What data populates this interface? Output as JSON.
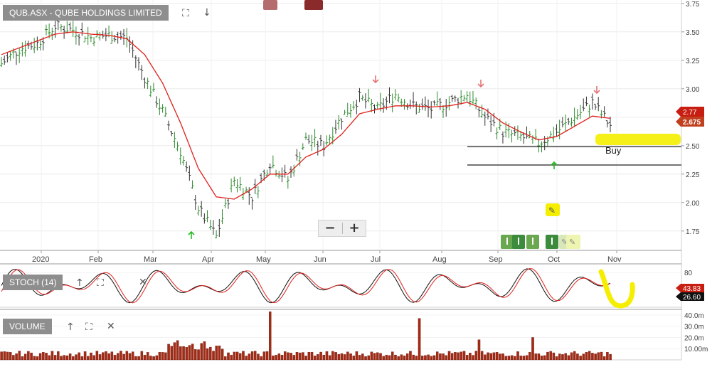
{
  "price_panel": {
    "title": "QUB.ASX - QUBE HOLDINGS LIMITED",
    "buy_label": "Buy"
  },
  "stoch_panel": {
    "title": "STOCH (14)"
  },
  "volume_panel": {
    "title": "VOLUME"
  },
  "price_badges": {
    "ma": "2.77",
    "last": "2.675"
  },
  "stoch_badges": {
    "d": "43.83",
    "k": "26.60"
  },
  "icons": {
    "expand": "expand-icon",
    "move_down": "arrow-down-icon",
    "move_up": "arrow-up-icon",
    "close": "close-icon",
    "zoom_out": "minus-icon",
    "zoom_in": "plus-icon",
    "pencil": "pencil-icon"
  },
  "colors": {
    "ma": "#e0201b",
    "up_bar": "#2e8b2e",
    "down_bar": "#333333",
    "volume": "#a52a14",
    "stoch_k": "#111111",
    "stoch_d": "#e0201b",
    "highlight": "#f5ee00",
    "buy_arrow": "#22bb22",
    "sell_arrow": "#e57373",
    "badge": "#c81e12"
  },
  "chart_data": [
    {
      "type": "line",
      "title": "QUB.ASX - QUBE HOLDINGS LIMITED",
      "x_tick_labels": [
        "2020",
        "Feb",
        "Mar",
        "Apr",
        "May",
        "Jun",
        "Jul",
        "Aug",
        "Sep",
        "Oct",
        "Nov"
      ],
      "y_tick_labels": [
        "1.75",
        "2.00",
        "2.25",
        "2.50",
        "2.75",
        "3.00",
        "3.25",
        "3.50",
        "3.75"
      ],
      "ylim": [
        1.58,
        3.78
      ],
      "grid": true,
      "series": [
        {
          "role": "price",
          "x": [
            "Jan",
            "Jan",
            "Jan",
            "Jan",
            "Feb",
            "Feb",
            "Feb",
            "Feb",
            "Mar",
            "Mar",
            "Mar",
            "Mar",
            "Mar",
            "Apr",
            "Apr",
            "Apr",
            "May",
            "May",
            "May",
            "Jun",
            "Jun",
            "Jun",
            "Jul",
            "Jul",
            "Jul",
            "Aug",
            "Aug",
            "Aug",
            "Sep",
            "Sep",
            "Sep",
            "Oct",
            "Oct",
            "Oct",
            "Oct"
          ],
          "values": [
            3.22,
            3.35,
            3.4,
            3.55,
            3.52,
            3.45,
            3.47,
            3.45,
            3.1,
            2.8,
            2.45,
            1.95,
            1.7,
            2.2,
            2.05,
            2.35,
            2.2,
            2.55,
            2.5,
            2.75,
            2.92,
            2.82,
            2.95,
            2.85,
            2.82,
            2.88,
            2.95,
            2.75,
            2.62,
            2.58,
            2.52,
            2.62,
            2.75,
            2.88,
            2.68
          ]
        },
        {
          "role": "moving-average",
          "values": [
            3.3,
            3.36,
            3.42,
            3.48,
            3.5,
            3.48,
            3.47,
            3.44,
            3.3,
            3.05,
            2.7,
            2.3,
            2.05,
            2.03,
            2.12,
            2.25,
            2.25,
            2.4,
            2.47,
            2.6,
            2.78,
            2.82,
            2.85,
            2.85,
            2.84,
            2.85,
            2.88,
            2.82,
            2.7,
            2.62,
            2.55,
            2.58,
            2.67,
            2.76,
            2.74
          ]
        }
      ],
      "annotations": {
        "buy_level": 2.49,
        "lower_level": 2.33,
        "buy_label": "Buy"
      },
      "last_price": 2.675,
      "ma_last": 2.77
    },
    {
      "type": "line",
      "title": "STOCH (14)",
      "y_tick_labels": [
        "80"
      ],
      "ylim": [
        0,
        100
      ],
      "last_k": 26.6,
      "last_d": 43.83
    },
    {
      "type": "bar",
      "title": "VOLUME",
      "y_tick_labels": [
        "10.00m",
        "20.0m",
        "30.0m",
        "40.0m"
      ],
      "ylim": [
        0,
        45
      ],
      "notable_values": [
        43,
        23,
        37,
        20
      ]
    }
  ]
}
